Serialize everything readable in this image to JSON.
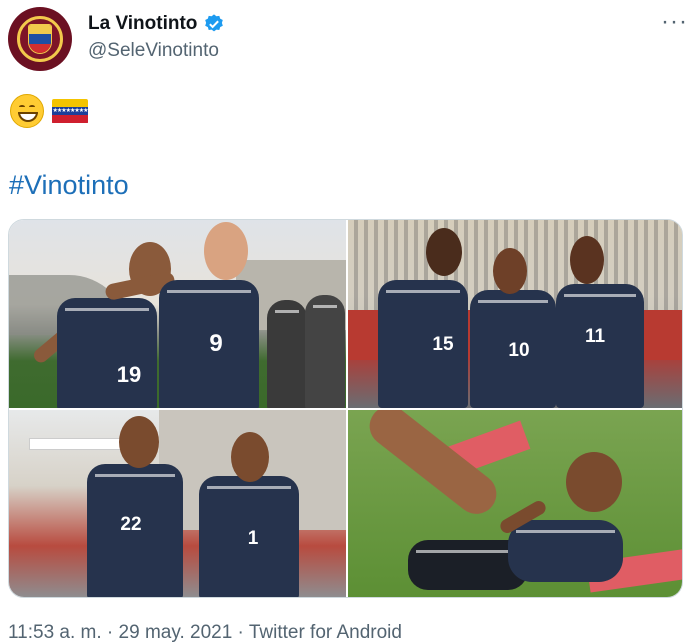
{
  "account": {
    "display_name": "La Vinotinto",
    "handle": "@SeleVinotinto",
    "verified": true,
    "brand_color": "#6b1022"
  },
  "menu": {
    "more_icon": "ellipsis-icon",
    "more_label": "···"
  },
  "tweet": {
    "emojis": [
      "grinning-face",
      "venezuela-flag"
    ],
    "hashtag": "#Vinotinto",
    "link_color": "#1d6fb8",
    "photos": [
      {
        "subject": "players",
        "jersey_numbers": [
          "19",
          "9"
        ]
      },
      {
        "subject": "players",
        "jersey_numbers": [
          "15",
          "10",
          "11"
        ]
      },
      {
        "subject": "players",
        "jersey_numbers": [
          "22",
          "1"
        ]
      },
      {
        "subject": "player-stretching",
        "jersey_numbers": []
      }
    ]
  },
  "meta": {
    "time": "11:53 a. m.",
    "separator": " · ",
    "date": "29 may. 2021",
    "source": "Twitter for Android"
  }
}
